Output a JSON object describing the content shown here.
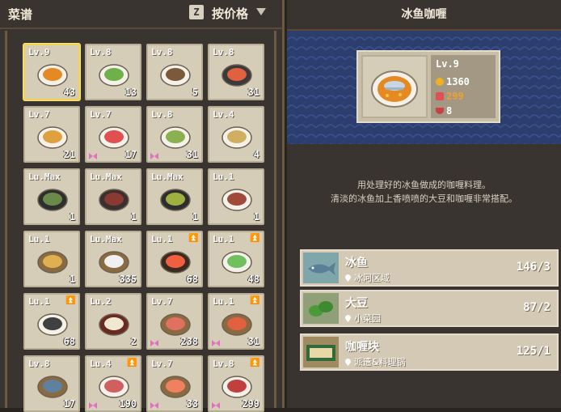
{
  "left_panel": {
    "title": "菜谱",
    "sort_key": "Z",
    "sort_label": "按价格"
  },
  "recipes": [
    {
      "level": "Lv.9",
      "count": "43",
      "dish": "fish-curry-plate",
      "selected": true,
      "upgrade": false,
      "bow": false
    },
    {
      "level": "Lv.8",
      "count": "13",
      "dish": "salad-plate",
      "selected": false,
      "upgrade": false,
      "bow": false
    },
    {
      "level": "Lv.8",
      "count": "5",
      "dish": "stew-plate",
      "selected": false,
      "upgrade": false,
      "bow": false
    },
    {
      "level": "Lv.8",
      "count": "31",
      "dish": "sushi-platter",
      "selected": false,
      "upgrade": false,
      "bow": false
    },
    {
      "level": "Lv.7",
      "count": "21",
      "dish": "fried-fish-plate",
      "selected": false,
      "upgrade": false,
      "bow": false
    },
    {
      "level": "Lv.7",
      "count": "17",
      "dish": "sashimi-plate",
      "selected": false,
      "upgrade": false,
      "bow": true
    },
    {
      "level": "Lv.8",
      "count": "31",
      "dish": "veg-bowl",
      "selected": false,
      "upgrade": false,
      "bow": true
    },
    {
      "level": "Lv.4",
      "count": "4",
      "dish": "sushi-rolls",
      "selected": false,
      "upgrade": false,
      "bow": false
    },
    {
      "level": "Lu.Max",
      "count": "1",
      "dish": "dark-bowl",
      "selected": false,
      "upgrade": false,
      "bow": false
    },
    {
      "level": "Lu.Max",
      "count": "1",
      "dish": "steak-plate",
      "selected": false,
      "upgrade": false,
      "bow": false
    },
    {
      "level": "Lu.Max",
      "count": "1",
      "dish": "veg-dark-bowl",
      "selected": false,
      "upgrade": false,
      "bow": false
    },
    {
      "level": "Lu.1",
      "count": "1",
      "dish": "roast-platter",
      "selected": false,
      "upgrade": false,
      "bow": false
    },
    {
      "level": "Lu.1",
      "count": "1",
      "dish": "tempura-stand",
      "selected": false,
      "upgrade": false,
      "bow": false
    },
    {
      "level": "Lu.Max",
      "count": "335",
      "dish": "nigiri-board",
      "selected": false,
      "upgrade": false,
      "bow": false
    },
    {
      "level": "Lu.1",
      "count": "68",
      "dish": "sushi-box",
      "selected": false,
      "upgrade": true,
      "bow": false
    },
    {
      "level": "Lu.1",
      "count": "48",
      "dish": "cucumber-plate",
      "selected": false,
      "upgrade": true,
      "bow": false
    },
    {
      "level": "Lu.1",
      "count": "68",
      "dish": "nigiri-plate",
      "selected": false,
      "upgrade": true,
      "bow": false
    },
    {
      "level": "Lu.2",
      "count": "2",
      "dish": "maki-box",
      "selected": false,
      "upgrade": false,
      "bow": false
    },
    {
      "level": "Lv.7",
      "count": "238",
      "dish": "meat-board",
      "selected": false,
      "upgrade": false,
      "bow": true
    },
    {
      "level": "Lu.1",
      "count": "31",
      "dish": "sushi-tray",
      "selected": false,
      "upgrade": true,
      "bow": true
    },
    {
      "level": "Lv.8",
      "count": "17",
      "dish": "whole-fish-board",
      "selected": false,
      "upgrade": false,
      "bow": false
    },
    {
      "level": "Lu.4",
      "count": "190",
      "dish": "ham-plate",
      "selected": false,
      "upgrade": true,
      "bow": true
    },
    {
      "level": "Lv.7",
      "count": "33",
      "dish": "salmon-nigiri",
      "selected": false,
      "upgrade": false,
      "bow": true
    },
    {
      "level": "Lv.8",
      "count": "299",
      "dish": "tuna-plate",
      "selected": false,
      "upgrade": true,
      "bow": true
    }
  ],
  "detail": {
    "title": "冰鱼咖喱",
    "level": "Lv.9",
    "price": "1360",
    "hearts": "299",
    "bowls": "8",
    "description_line1": "用处理好的冰鱼做成的咖喱料理。",
    "description_line2": "清淡的冰鱼加上香喷喷的大豆和咖喱非常搭配。",
    "colors": {
      "price": "#ffffff",
      "hearts": "#f0a030",
      "bowls": "#ffffff",
      "banner": "#2b3e6e"
    }
  },
  "ingredients": [
    {
      "name": "冰鱼",
      "location": "冰河区域",
      "amount": "146/3",
      "icon": "ice-fish-icon"
    },
    {
      "name": "大豆",
      "location": "小菜园",
      "amount": "87/2",
      "icon": "soybean-icon"
    },
    {
      "name": "咖喱块",
      "location": "派遣&料理锅",
      "amount": "125/1",
      "icon": "curry-block-icon"
    }
  ]
}
